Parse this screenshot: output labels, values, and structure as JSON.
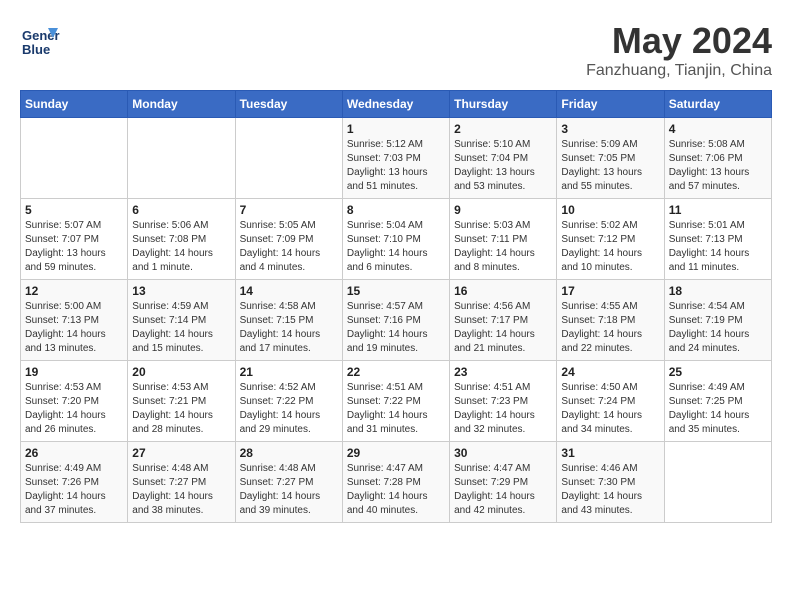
{
  "header": {
    "logo_line1": "General",
    "logo_line2": "Blue",
    "month": "May 2024",
    "location": "Fanzhuang, Tianjin, China"
  },
  "weekdays": [
    "Sunday",
    "Monday",
    "Tuesday",
    "Wednesday",
    "Thursday",
    "Friday",
    "Saturday"
  ],
  "weeks": [
    [
      {
        "day": "",
        "info": ""
      },
      {
        "day": "",
        "info": ""
      },
      {
        "day": "",
        "info": ""
      },
      {
        "day": "1",
        "info": "Sunrise: 5:12 AM\nSunset: 7:03 PM\nDaylight: 13 hours\nand 51 minutes."
      },
      {
        "day": "2",
        "info": "Sunrise: 5:10 AM\nSunset: 7:04 PM\nDaylight: 13 hours\nand 53 minutes."
      },
      {
        "day": "3",
        "info": "Sunrise: 5:09 AM\nSunset: 7:05 PM\nDaylight: 13 hours\nand 55 minutes."
      },
      {
        "day": "4",
        "info": "Sunrise: 5:08 AM\nSunset: 7:06 PM\nDaylight: 13 hours\nand 57 minutes."
      }
    ],
    [
      {
        "day": "5",
        "info": "Sunrise: 5:07 AM\nSunset: 7:07 PM\nDaylight: 13 hours\nand 59 minutes."
      },
      {
        "day": "6",
        "info": "Sunrise: 5:06 AM\nSunset: 7:08 PM\nDaylight: 14 hours\nand 1 minute."
      },
      {
        "day": "7",
        "info": "Sunrise: 5:05 AM\nSunset: 7:09 PM\nDaylight: 14 hours\nand 4 minutes."
      },
      {
        "day": "8",
        "info": "Sunrise: 5:04 AM\nSunset: 7:10 PM\nDaylight: 14 hours\nand 6 minutes."
      },
      {
        "day": "9",
        "info": "Sunrise: 5:03 AM\nSunset: 7:11 PM\nDaylight: 14 hours\nand 8 minutes."
      },
      {
        "day": "10",
        "info": "Sunrise: 5:02 AM\nSunset: 7:12 PM\nDaylight: 14 hours\nand 10 minutes."
      },
      {
        "day": "11",
        "info": "Sunrise: 5:01 AM\nSunset: 7:13 PM\nDaylight: 14 hours\nand 11 minutes."
      }
    ],
    [
      {
        "day": "12",
        "info": "Sunrise: 5:00 AM\nSunset: 7:13 PM\nDaylight: 14 hours\nand 13 minutes."
      },
      {
        "day": "13",
        "info": "Sunrise: 4:59 AM\nSunset: 7:14 PM\nDaylight: 14 hours\nand 15 minutes."
      },
      {
        "day": "14",
        "info": "Sunrise: 4:58 AM\nSunset: 7:15 PM\nDaylight: 14 hours\nand 17 minutes."
      },
      {
        "day": "15",
        "info": "Sunrise: 4:57 AM\nSunset: 7:16 PM\nDaylight: 14 hours\nand 19 minutes."
      },
      {
        "day": "16",
        "info": "Sunrise: 4:56 AM\nSunset: 7:17 PM\nDaylight: 14 hours\nand 21 minutes."
      },
      {
        "day": "17",
        "info": "Sunrise: 4:55 AM\nSunset: 7:18 PM\nDaylight: 14 hours\nand 22 minutes."
      },
      {
        "day": "18",
        "info": "Sunrise: 4:54 AM\nSunset: 7:19 PM\nDaylight: 14 hours\nand 24 minutes."
      }
    ],
    [
      {
        "day": "19",
        "info": "Sunrise: 4:53 AM\nSunset: 7:20 PM\nDaylight: 14 hours\nand 26 minutes."
      },
      {
        "day": "20",
        "info": "Sunrise: 4:53 AM\nSunset: 7:21 PM\nDaylight: 14 hours\nand 28 minutes."
      },
      {
        "day": "21",
        "info": "Sunrise: 4:52 AM\nSunset: 7:22 PM\nDaylight: 14 hours\nand 29 minutes."
      },
      {
        "day": "22",
        "info": "Sunrise: 4:51 AM\nSunset: 7:22 PM\nDaylight: 14 hours\nand 31 minutes."
      },
      {
        "day": "23",
        "info": "Sunrise: 4:51 AM\nSunset: 7:23 PM\nDaylight: 14 hours\nand 32 minutes."
      },
      {
        "day": "24",
        "info": "Sunrise: 4:50 AM\nSunset: 7:24 PM\nDaylight: 14 hours\nand 34 minutes."
      },
      {
        "day": "25",
        "info": "Sunrise: 4:49 AM\nSunset: 7:25 PM\nDaylight: 14 hours\nand 35 minutes."
      }
    ],
    [
      {
        "day": "26",
        "info": "Sunrise: 4:49 AM\nSunset: 7:26 PM\nDaylight: 14 hours\nand 37 minutes."
      },
      {
        "day": "27",
        "info": "Sunrise: 4:48 AM\nSunset: 7:27 PM\nDaylight: 14 hours\nand 38 minutes."
      },
      {
        "day": "28",
        "info": "Sunrise: 4:48 AM\nSunset: 7:27 PM\nDaylight: 14 hours\nand 39 minutes."
      },
      {
        "day": "29",
        "info": "Sunrise: 4:47 AM\nSunset: 7:28 PM\nDaylight: 14 hours\nand 40 minutes."
      },
      {
        "day": "30",
        "info": "Sunrise: 4:47 AM\nSunset: 7:29 PM\nDaylight: 14 hours\nand 42 minutes."
      },
      {
        "day": "31",
        "info": "Sunrise: 4:46 AM\nSunset: 7:30 PM\nDaylight: 14 hours\nand 43 minutes."
      },
      {
        "day": "",
        "info": ""
      }
    ]
  ]
}
